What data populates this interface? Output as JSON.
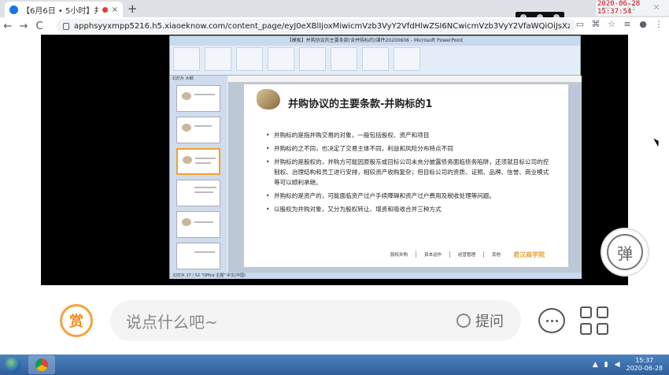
{
  "browser": {
    "tab_title": "【6月6日 • 5小时】并购法律",
    "tab_close": "×",
    "new_tab": "+",
    "url": "apphsyyxmpp5216.h5.xiaoeknow.com/content_page/eyJ0eXBlIjoxMiwicmVzb3VyY2VfdHlwZSI6NCwicmVzb3VyY2VfaWQiOiJsXzVlY2I4NmMwNmE2ZjEz...",
    "nav": {
      "back": "←",
      "forward": "→",
      "reload": "C"
    },
    "window_controls": {
      "minimize": "—",
      "maximize": "☐",
      "close": "✕"
    },
    "recording_clock": "2020-06-28 15:37:54"
  },
  "ppt": {
    "window_title": "【模板】并购协议的主要条款(含并购标的)课件20200606 - Microsoft PowerPoint",
    "thumb_tabs": "幻灯片  大纲",
    "status_bar": "幻灯片 17 / 52   \"Office 主题\"   中文(中国)",
    "slide": {
      "title": "并购协议的主要条款-并购标的1",
      "bullets": [
        "并购标的是指并购交易的对象，一般包括股权、资产和项目",
        "并购标的之不同，也决定了交易主体不同，利益和风险分布特点不同",
        "并购标的是股权的，并购方可能因原股东或目标公司未充分披露债务面临债务陷阱，还须就目标公司的控制权、治理结构和员工进行安排，相较资产收购复杂；但目标公司的资质、证照、品牌、信誉、商业模式等可以顺利承继。",
        "并购标的是资产的，可能面临资产过户手续障碍和资产过户费用及税收处理等问题。",
        "以股权为并购对象，又分为股权转让、增资和吸收合并三种方式"
      ],
      "footer": [
        "股权并购",
        "资本运作",
        "经营管理",
        "其他"
      ],
      "brand": "君汉商学院"
    }
  },
  "player": {
    "danmu_button": "弹"
  },
  "chat": {
    "reward_label": "赏",
    "input_placeholder": "说点什么吧~",
    "ask_label": "提问"
  },
  "taskbar": {
    "time": "15:37",
    "date": "2020-06-28"
  }
}
